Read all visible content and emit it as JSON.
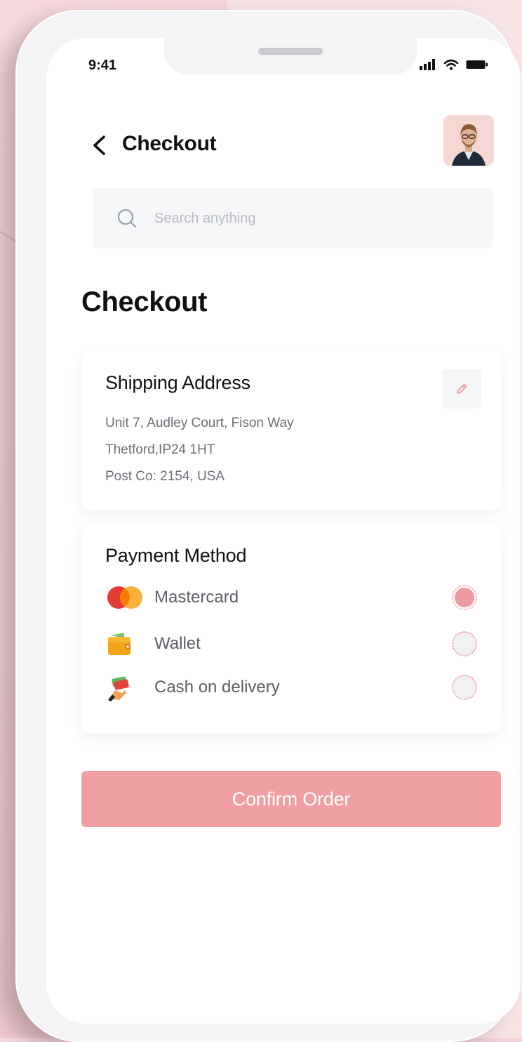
{
  "status_bar": {
    "time": "9:41",
    "icons": [
      "signal-icon",
      "wifi-icon",
      "battery-icon"
    ]
  },
  "header": {
    "title": "Checkout",
    "back_icon": "chevron-left-icon"
  },
  "search": {
    "placeholder": "Search anything",
    "icon": "search-icon"
  },
  "main": {
    "title": "Checkout"
  },
  "shipping": {
    "title": "Shipping Address",
    "edit_icon": "pencil-icon",
    "lines": [
      "Unit 7, Audley Court, Fison Way",
      "Thetford,IP24 1HT",
      "Post Co: 2154, USA"
    ]
  },
  "payment": {
    "title": "Payment Method",
    "options": [
      {
        "label": "Mastercard",
        "icon": "mastercard-icon",
        "selected": true
      },
      {
        "label": "Wallet",
        "icon": "wallet-icon",
        "selected": false
      },
      {
        "label": "Cash on delivery",
        "icon": "cash-icon",
        "selected": false
      }
    ]
  },
  "confirm_label": "Confirm Order",
  "colors": {
    "accent": "#EF9FA1",
    "card_bg": "#FFFFFF",
    "muted_text": "#6B6F77"
  }
}
